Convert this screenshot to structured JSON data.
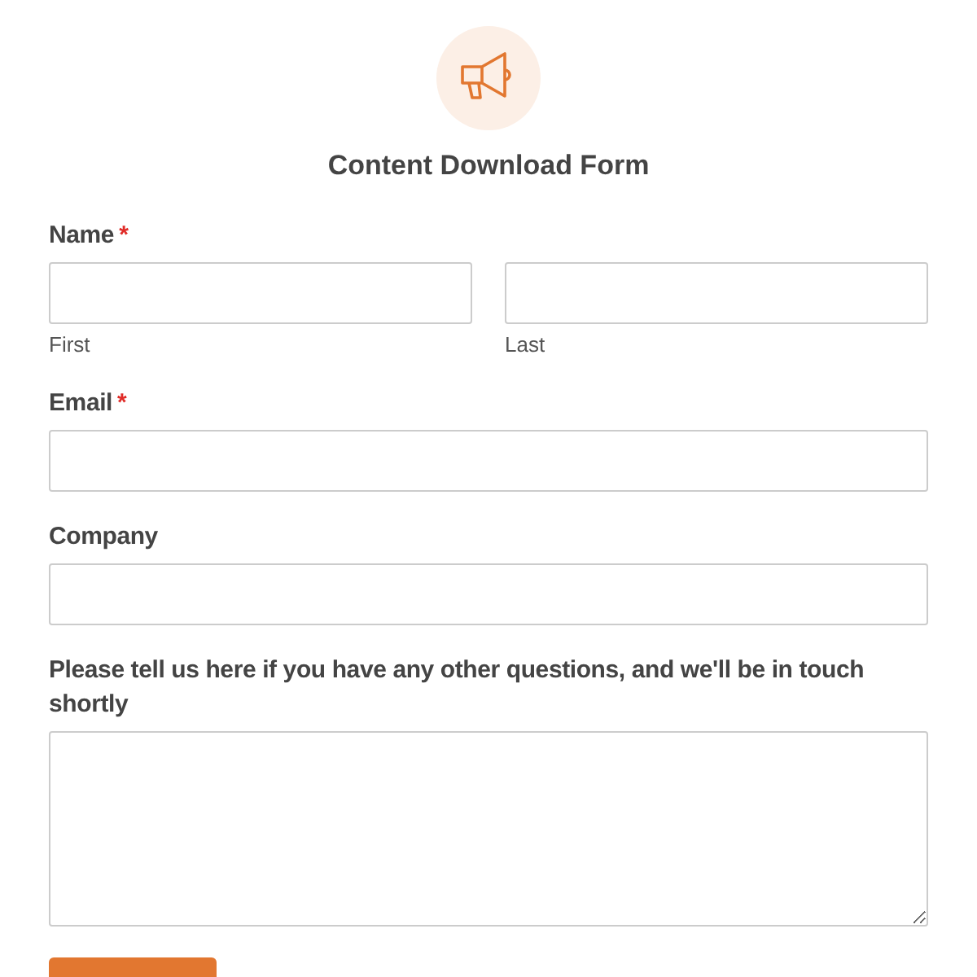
{
  "title": "Content Download Form",
  "fields": [
    {
      "kind": "name",
      "label": "Name",
      "required_mark": "*",
      "sublabels": [
        "First",
        "Last"
      ]
    },
    {
      "kind": "text",
      "label": "Email",
      "required_mark": "*"
    },
    {
      "kind": "text",
      "label": "Company"
    },
    {
      "kind": "textarea",
      "label": "Please tell us here if you have any other questions, and we'll be in touch shortly"
    }
  ],
  "buttons": [
    {
      "kind": "submit"
    }
  ]
}
